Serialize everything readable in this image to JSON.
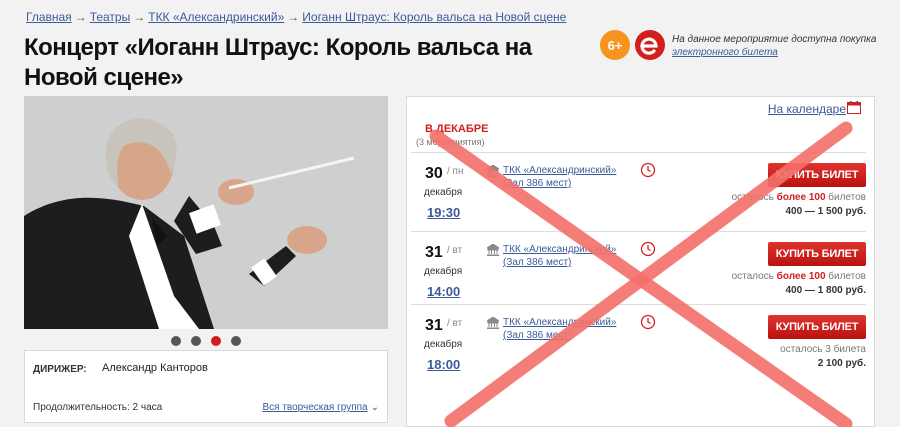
{
  "breadcrumb": {
    "items": [
      "Главная",
      "Театры",
      "ТКК «Александринский»",
      "Иоганн Штраус: Король вальса на Новой сцене"
    ],
    "separator": "→"
  },
  "event": {
    "title": "Концерт «Иоганн Штраус: Король вальса на Новой сцене»",
    "age_rating": "6+",
    "eticket_note": "На данное мероприятие доступна покупка",
    "eticket_link": "электронного билета"
  },
  "gallery": {
    "dots": 4,
    "active_dot": 2
  },
  "info": {
    "role_label": "ДИРИЖЕР:",
    "person": "Александр Канторов",
    "duration": "Продолжительность: 2 часа",
    "group_link": "Вся творческая группа",
    "group_chevron": "⌄"
  },
  "schedule": {
    "calendar_link": "На календаре",
    "month_title": "В ДЕКАБРЕ",
    "month_count": "(3 мероприятия)",
    "rows": [
      {
        "day": "30",
        "dow": "/ пн",
        "month": "декабря",
        "time": "19:30",
        "venue_name": "ТКК «Александринский»",
        "venue_hall": "(Зал 386 мест)",
        "buy_label": "КУПИТЬ БИЛЕТ",
        "avail_prefix": "осталось ",
        "avail_highlight": "более 100",
        "avail_suffix": " билетов",
        "price": "400 — 1 500 руб."
      },
      {
        "day": "31",
        "dow": "/ вт",
        "month": "декабря",
        "time": "14:00",
        "venue_name": "ТКК «Александринский»",
        "venue_hall": "(Зал 386 мест)",
        "buy_label": "КУПИТЬ БИЛЕТ",
        "avail_prefix": "осталось ",
        "avail_highlight": "более 100",
        "avail_suffix": " билетов",
        "price": "400 — 1 800 руб."
      },
      {
        "day": "31",
        "dow": "/ вт",
        "month": "декабря",
        "time": "18:00",
        "venue_name": "ТКК «Александринский»",
        "venue_hall": "(Зал 386 мест)",
        "buy_label": "КУПИТЬ БИЛЕТ",
        "avail_prefix": "осталось ",
        "avail_highlight": "",
        "avail_suffix": "3 билета",
        "price": "2 100 руб."
      }
    ]
  },
  "colors": {
    "accent_red": "#d21e1e",
    "link_blue": "#3b5b99",
    "age_badge": "#f7941d",
    "cross_overlay": "#f4706a"
  },
  "icons": {
    "eticket": "e-ticket-icon",
    "calendar": "calendar-icon",
    "venue": "theater-building-icon",
    "clock": "clock-icon",
    "cross": "cross-overlay"
  }
}
